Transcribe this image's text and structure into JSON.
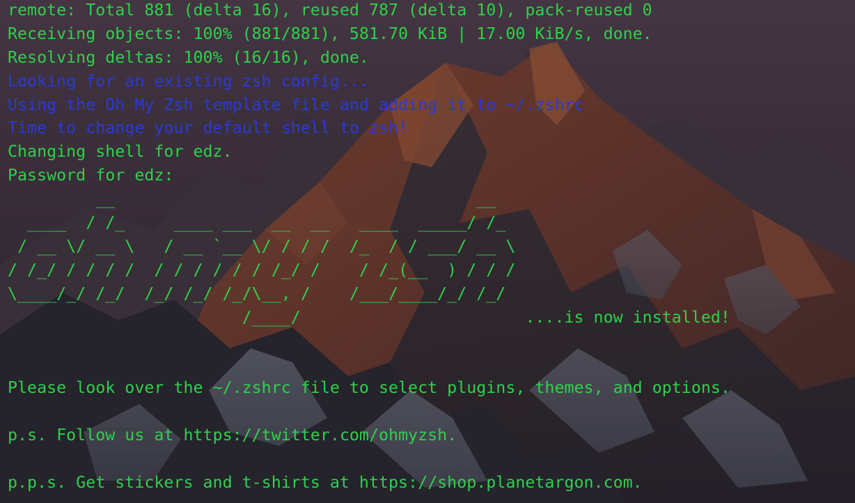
{
  "colors": {
    "text_green": "#2fd14a",
    "text_blue": "#2a3ad6"
  },
  "terminal": {
    "lines": [
      {
        "text": "remote: Total 881 (delta 16), reused 787 (delta 10), pack-reused 0",
        "color": "green"
      },
      {
        "text": "Receiving objects: 100% (881/881), 581.70 KiB | 17.00 KiB/s, done.",
        "color": "green"
      },
      {
        "text": "Resolving deltas: 100% (16/16), done.",
        "color": "green"
      },
      {
        "text": "Looking for an existing zsh config...",
        "color": "blue"
      },
      {
        "text": "Using the Oh My Zsh template file and adding it to ~/.zshrc",
        "color": "blue"
      },
      {
        "text": "Time to change your default shell to zsh!",
        "color": "blue"
      },
      {
        "text": "Changing shell for edz.",
        "color": "green"
      },
      {
        "text": "Password for edz:",
        "color": "green"
      },
      {
        "text": "         __                                     __",
        "color": "green"
      },
      {
        "text": "  ____  / /_     ____ ___  __  __   ____  _____/ /_",
        "color": "green"
      },
      {
        "text": " / __ \\/ __ \\   / __ `__ \\/ / / /  /_  / / ___/ __ \\",
        "color": "green"
      },
      {
        "text": "/ /_/ / / / /  / / / / / / /_/ /    / /_(__  ) / / /",
        "color": "green"
      },
      {
        "text": "\\____/_/ /_/  /_/ /_/ /_/\\__, /    /___/____/_/ /_/",
        "color": "green"
      },
      {
        "text": "                        /____/                       ....is now installed!",
        "color": "green"
      },
      {
        "text": "",
        "color": "green"
      },
      {
        "text": "",
        "color": "green"
      },
      {
        "text": "Please look over the ~/.zshrc file to select plugins, themes, and options.",
        "color": "green"
      },
      {
        "text": "",
        "color": "green"
      },
      {
        "text": "p.s. Follow us at https://twitter.com/ohmyzsh.",
        "color": "green"
      },
      {
        "text": "",
        "color": "green"
      },
      {
        "text": "p.p.s. Get stickers and t-shirts at https://shop.planetargon.com.",
        "color": "green"
      }
    ]
  }
}
